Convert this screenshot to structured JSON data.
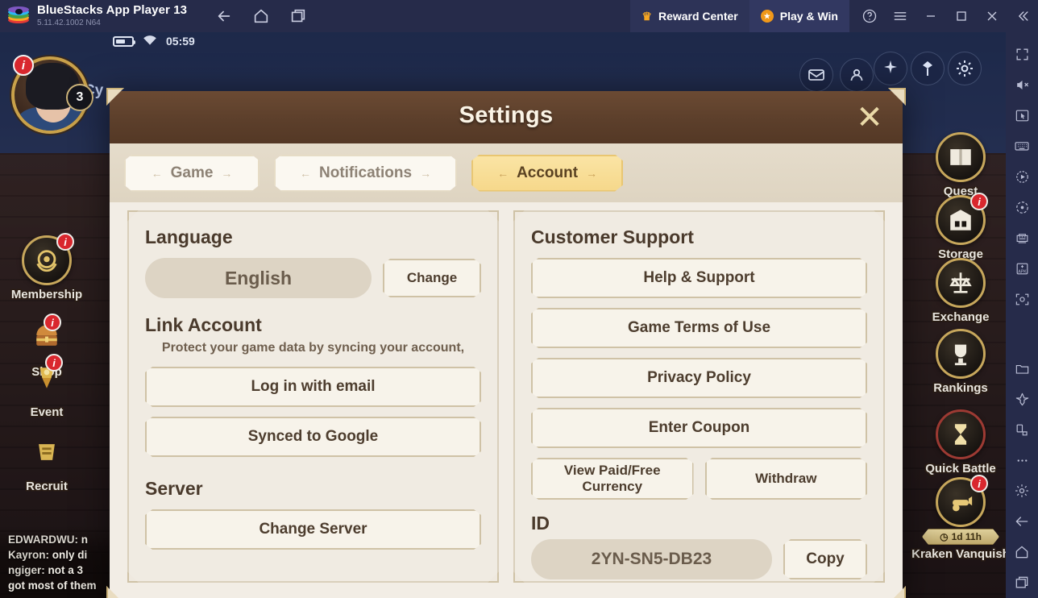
{
  "titlebar": {
    "app_name": "BlueStacks App Player 13",
    "version": "5.11.42.1002  N64",
    "nav": [
      {
        "name": "back-icon",
        "label": "Back"
      },
      {
        "name": "home-icon",
        "label": "Home"
      },
      {
        "name": "multi-instance-icon",
        "label": "Multi-instance"
      }
    ],
    "reward_center": "Reward Center",
    "play_win": "Play & Win",
    "window_controls": [
      "help-icon",
      "menu-icon",
      "minimize-icon",
      "maximize-icon",
      "close-icon",
      "collapse-icon"
    ]
  },
  "android": {
    "status_time": "05:59",
    "battery_icon": "battery-icon",
    "wifi_icon": "wifi-icon",
    "player_name": "Cy"
  },
  "player": {
    "level": "3",
    "notice_badge": "i"
  },
  "left_menu": [
    {
      "label": "Membership",
      "icon": "membership-emblem-icon",
      "badge": "i"
    },
    {
      "label": "Shop",
      "icon": "treasure-chest-icon",
      "badge": "i"
    },
    {
      "label": "Event",
      "icon": "event-banner-icon",
      "badge": "i"
    },
    {
      "label": "Recruit",
      "icon": "recruit-scroll-icon",
      "badge": ""
    }
  ],
  "right_menu": [
    {
      "label": "Quest",
      "icon": "book-icon",
      "badge": "",
      "timer": ""
    },
    {
      "label": "Storage",
      "icon": "warehouse-icon",
      "badge": "i",
      "timer": ""
    },
    {
      "label": "Exchange",
      "icon": "scales-icon",
      "badge": "",
      "timer": ""
    },
    {
      "label": "Rankings",
      "icon": "trophy-icon",
      "badge": "",
      "timer": ""
    },
    {
      "label": "Quick Battle",
      "icon": "hourglass-icon",
      "badge": "",
      "timer": ""
    },
    {
      "label": "Kraken Vanquish",
      "icon": "cannon-icon",
      "badge": "i",
      "timer": "1d 11h"
    }
  ],
  "top_right_buttons": [
    {
      "name": "mail-icon"
    },
    {
      "name": "person-icon"
    },
    {
      "name": "sparkle-icon"
    },
    {
      "name": "banner-icon"
    },
    {
      "name": "settings-gear-icon"
    }
  ],
  "chat": [
    {
      "user": "EDWARDWU:",
      "text": "n"
    },
    {
      "user": "Kayron:",
      "text": "only di"
    },
    {
      "user": "ngiger:",
      "text": "not a 3 "
    },
    {
      "user": "",
      "text": "got most of them"
    }
  ],
  "modal": {
    "title": "Settings",
    "close_label": "✕",
    "tabs": [
      {
        "label": "Game",
        "active": false
      },
      {
        "label": "Notifications",
        "active": false
      },
      {
        "label": "Account",
        "active": true
      }
    ],
    "left_panel": {
      "language_title": "Language",
      "language_value": "English",
      "language_change_button": "Change",
      "link_account_title": "Link Account",
      "link_account_desc": "Protect your game data by syncing your account,",
      "login_email_button": "Log in with email",
      "google_sync_button": "Synced to Google",
      "server_title": "Server",
      "change_server_button": "Change Server"
    },
    "right_panel": {
      "support_title": "Customer Support",
      "help_button": "Help & Support",
      "terms_button": "Game Terms of Use",
      "privacy_button": "Privacy Policy",
      "coupon_button": "Enter Coupon",
      "currency_button": "View Paid/Free Currency",
      "withdraw_button": "Withdraw",
      "id_title": "ID",
      "id_value": "2YN-SN5-DB23",
      "copy_button": "Copy"
    }
  },
  "bs_sidebar": [
    {
      "name": "fullscreen-icon"
    },
    {
      "name": "mute-icon"
    },
    {
      "name": "cursor-icon"
    },
    {
      "name": "keyboard-icon"
    },
    {
      "name": "macro-play-icon"
    },
    {
      "name": "record-icon"
    },
    {
      "name": "multi-instance-manager-icon"
    },
    {
      "name": "install-apk-icon"
    },
    {
      "name": "screenshot-icon"
    },
    {
      "name": "media-folder-icon"
    },
    {
      "name": "eco-mode-icon"
    },
    {
      "name": "rotate-icon"
    },
    {
      "name": "more-icon"
    },
    {
      "name": "settings-icon"
    },
    {
      "name": "back-icon"
    },
    {
      "name": "home-icon"
    },
    {
      "name": "recents-icon"
    }
  ],
  "colors": {
    "titlebar_bg": "#262b4a",
    "modal_header": "#5c3f2b",
    "modal_body": "#f2ede5",
    "tab_active": "#f6d88b",
    "badge_red": "#d9272e",
    "frame_gold": "#d9c79a"
  }
}
